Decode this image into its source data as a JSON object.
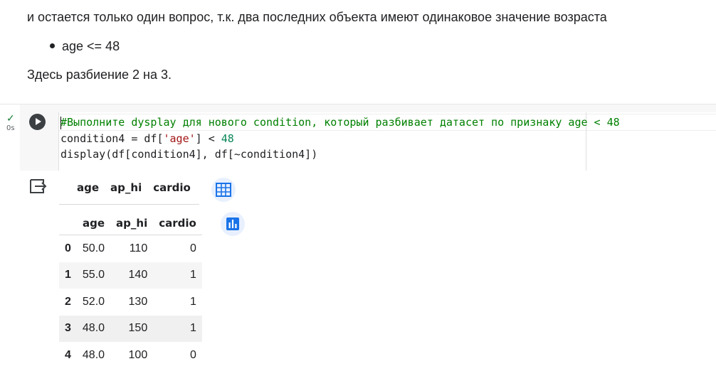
{
  "markdown": {
    "line1": "и остается только один вопрос, т.к. два последних объекта имеют одинаковое значение возраста",
    "bullet": "age <= 48",
    "line3": "Здесь разбиение 2 на 3."
  },
  "cell": {
    "status_check": "✓",
    "exec_time": "0s",
    "code": {
      "comment": "#Выполните dysplay для нового condition, который разбивает датасет по признаку age < 48",
      "line2_a": "condition4 = df[",
      "line2_str": "'age'",
      "line2_b": "] < ",
      "line2_num": "48",
      "line3": "display(df[condition4], df[~condition4])"
    }
  },
  "output": {
    "first_df": {
      "columns": [
        "age",
        "ap_hi",
        "cardio"
      ]
    },
    "second_df": {
      "columns": [
        "",
        "age",
        "ap_hi",
        "cardio"
      ],
      "rows": [
        [
          "0",
          "50.0",
          "110",
          "0"
        ],
        [
          "1",
          "55.0",
          "140",
          "1"
        ],
        [
          "2",
          "52.0",
          "130",
          "1"
        ],
        [
          "3",
          "48.0",
          "150",
          "1"
        ],
        [
          "4",
          "48.0",
          "100",
          "0"
        ]
      ]
    },
    "icons": [
      "output-redirect-icon",
      "table-icon",
      "bar-chart-icon"
    ]
  },
  "colors": {
    "accent": "#1a73e8",
    "comment": "#008000",
    "string": "#a31515",
    "number": "#098658"
  }
}
